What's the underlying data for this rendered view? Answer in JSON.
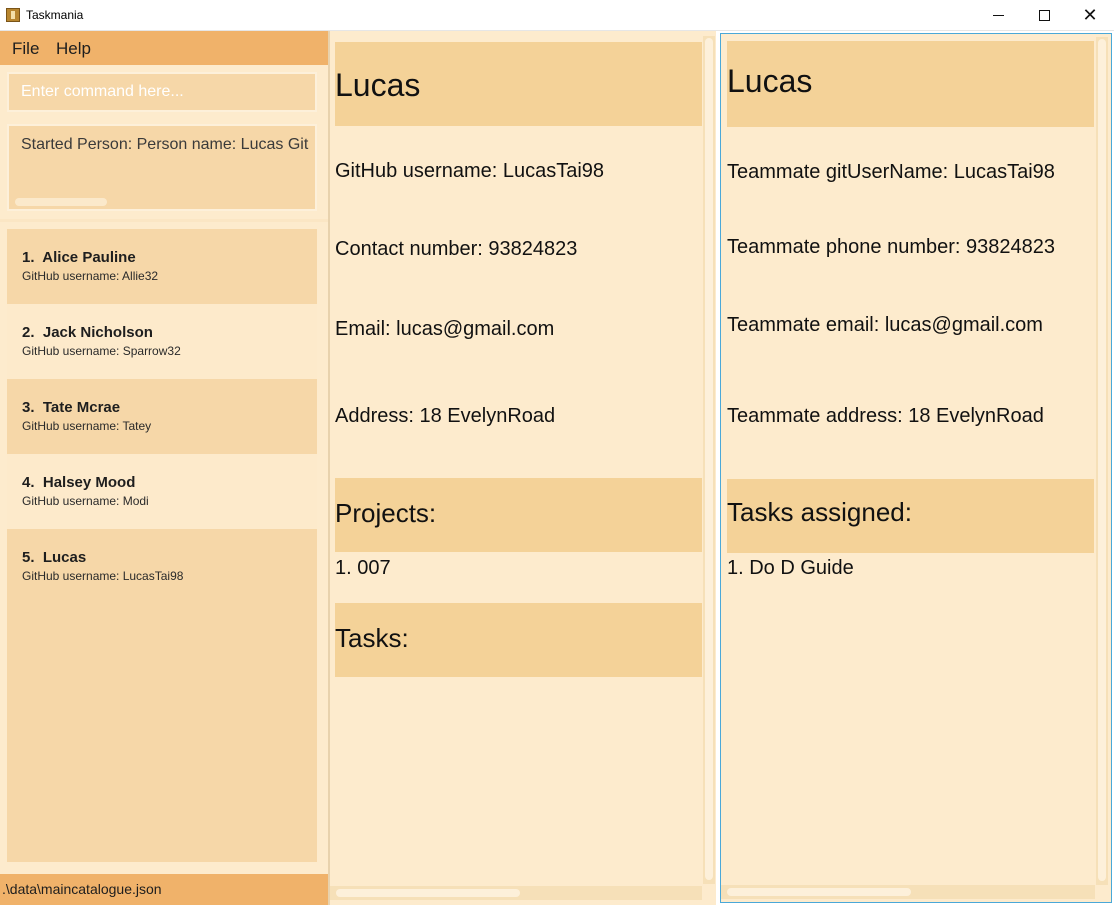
{
  "window": {
    "title": "Taskmania",
    "minimize_icon": "minimize-icon",
    "maximize_icon": "maximize-icon",
    "close_icon": "close-icon",
    "close_glyph": "✕"
  },
  "menu": {
    "file": "File",
    "help": "Help"
  },
  "command": {
    "placeholder": "Enter command here...",
    "value": ""
  },
  "result": {
    "text": "Started Person:  Person name: Lucas Git"
  },
  "persons": [
    {
      "index": "1.",
      "name": "Alice Pauline",
      "github": "GitHub username: Allie32"
    },
    {
      "index": "2.",
      "name": "Jack Nicholson",
      "github": "GitHub username: Sparrow32"
    },
    {
      "index": "3.",
      "name": "Tate Mcrae",
      "github": "GitHub username: Tatey"
    },
    {
      "index": "4.",
      "name": "Halsey Mood",
      "github": "GitHub username: Modi"
    },
    {
      "index": "5.",
      "name": "Lucas",
      "github": "GitHub username: LucasTai98"
    }
  ],
  "status": {
    "path": ".\\data\\maincatalogue.json"
  },
  "person_detail": {
    "name": "Lucas",
    "github": "GitHub username: LucasTai98",
    "contact": "Contact number: 93824823",
    "email": "Email: lucas@gmail.com",
    "address": "Address: 18 EvelynRoad",
    "projects_header": "Projects:",
    "projects": [
      "1. 007"
    ],
    "tasks_header": "Tasks:"
  },
  "teammate_detail": {
    "name": "Lucas",
    "git_user": "Teammate gitUserName: LucasTai98",
    "phone": "Teammate phone number: 93824823",
    "email": "Teammate email: lucas@gmail.com",
    "address": "Teammate address: 18 EvelynRoad",
    "tasks_header": "Tasks assigned:",
    "tasks": [
      "1. Do D Guide"
    ]
  },
  "colors": {
    "menu_bar": "#f0b26a",
    "panel_bg": "#fdebcd",
    "header_band": "#f4d298",
    "card_dark": "#f6d7a8",
    "focus_border": "#4aa8d8"
  }
}
